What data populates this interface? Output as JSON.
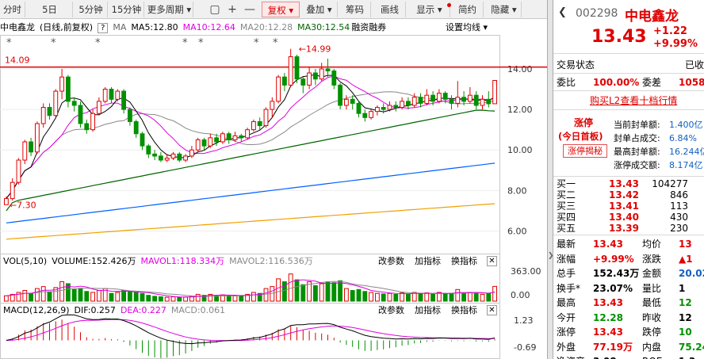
{
  "toolbar": {
    "items": [
      {
        "label": "分时",
        "active": false
      },
      {
        "label": "5日",
        "active": false
      },
      {
        "label": "5分钟",
        "active": false
      },
      {
        "label": "15分钟",
        "active": false
      },
      {
        "label": "更多周期 ▾",
        "active": false
      },
      {
        "label": "复权 ▾",
        "active": true
      },
      {
        "label": "叠加 ▾",
        "active": false
      },
      {
        "label": "筹码",
        "active": false
      },
      {
        "label": "画线",
        "active": false
      },
      {
        "label": "显示 ▾",
        "active": false
      },
      {
        "label": "简约",
        "active": false
      },
      {
        "label": "隐藏 ▾",
        "active": false
      }
    ],
    "icons": [
      "▢",
      "+",
      "—"
    ]
  },
  "main_indicators": {
    "stock": "中电鑫龙",
    "mode": "(日线,前复权)",
    "help": "?",
    "ma": "MA",
    "ma5": "MA5:12.80",
    "ma10": "MA10:12.64",
    "ma20": "MA20:12.28",
    "ma30": "MA30:12.54",
    "rz": "融资融券",
    "settings": "设置均线 ▾"
  },
  "vol_indicators": {
    "name": "VOL(5,10)",
    "volume": "VOLUME:152.426万",
    "mavol1": "MAVOL1:118.334万",
    "mavol2": "MAVOL2:116.536万",
    "btn1": "改参数",
    "btn2": "加指标",
    "btn3": "换指标",
    "close": "✕"
  },
  "macd_indicators": {
    "name": "MACD(12,26,9)",
    "dif": "DIF:0.257",
    "dea": "DEA:0.227",
    "macd": "MACD:0.061",
    "btn1": "改参数",
    "btn2": "加指标",
    "btn3": "换指标",
    "close": "✕"
  },
  "colors": {
    "up": "#e00000",
    "down": "#009000",
    "ma5": "#000000",
    "ma10": "#e000e0",
    "ma20": "#888888",
    "ma30": "#006400",
    "ma60": "#0060ff",
    "ma120": "#f0a000",
    "resistance": "#e00000"
  },
  "chart_data": {
    "type": "candlestick",
    "y_ticks": [
      "14.00",
      "12.00",
      "10.00",
      "8.00",
      "6.00"
    ],
    "ylim": [
      5.2,
      15.6
    ],
    "resistance_label": "14.09",
    "resistance_value": 14.09,
    "high_label": "14.99",
    "low_label": "7.30",
    "candles": [
      [
        7.3,
        7.6,
        7.3,
        7.7
      ],
      [
        7.6,
        8.4,
        7.5,
        8.6
      ],
      [
        8.4,
        9.5,
        8.3,
        9.6
      ],
      [
        9.5,
        10.4,
        9.3,
        10.5
      ],
      [
        10.4,
        9.9,
        9.7,
        10.6
      ],
      [
        9.9,
        11.3,
        9.8,
        11.4
      ],
      [
        11.3,
        12.1,
        11.1,
        12.3
      ],
      [
        12.1,
        11.7,
        11.5,
        12.3
      ],
      [
        11.7,
        12.9,
        11.6,
        13.0
      ],
      [
        12.9,
        13.6,
        12.5,
        14.0
      ],
      [
        13.6,
        12.4,
        12.1,
        13.7
      ],
      [
        12.4,
        12.2,
        11.9,
        12.6
      ],
      [
        12.2,
        11.3,
        11.1,
        12.4
      ],
      [
        11.3,
        11.0,
        10.8,
        11.5
      ],
      [
        11.0,
        11.8,
        10.9,
        12.0
      ],
      [
        11.8,
        12.4,
        11.7,
        12.6
      ],
      [
        12.4,
        13.0,
        12.3,
        13.1
      ],
      [
        13.0,
        12.5,
        12.3,
        13.1
      ],
      [
        12.5,
        12.9,
        12.4,
        13.0
      ],
      [
        12.9,
        12.0,
        11.8,
        13.0
      ],
      [
        12.0,
        11.4,
        11.2,
        12.1
      ],
      [
        11.4,
        10.8,
        10.6,
        11.5
      ],
      [
        10.8,
        10.2,
        10.0,
        10.9
      ],
      [
        10.2,
        9.8,
        9.6,
        10.3
      ],
      [
        9.8,
        9.7,
        9.5,
        10.0
      ],
      [
        9.7,
        9.5,
        9.4,
        9.9
      ],
      [
        9.5,
        9.6,
        9.4,
        9.8
      ],
      [
        9.6,
        9.8,
        9.5,
        9.9
      ],
      [
        9.8,
        9.5,
        9.4,
        9.9
      ],
      [
        9.5,
        9.7,
        9.4,
        9.8
      ],
      [
        9.7,
        10.0,
        9.6,
        10.2
      ],
      [
        10.0,
        10.5,
        9.9,
        10.6
      ],
      [
        10.5,
        10.2,
        10.0,
        10.6
      ],
      [
        10.2,
        10.6,
        10.1,
        10.8
      ],
      [
        10.6,
        10.4,
        10.2,
        10.8
      ],
      [
        10.4,
        10.8,
        10.3,
        10.9
      ],
      [
        10.8,
        10.5,
        10.3,
        10.9
      ],
      [
        10.5,
        10.7,
        10.4,
        10.9
      ],
      [
        10.7,
        10.6,
        10.4,
        10.8
      ],
      [
        10.6,
        11.0,
        10.5,
        11.1
      ],
      [
        11.0,
        11.4,
        10.9,
        11.5
      ],
      [
        11.4,
        11.2,
        11.0,
        11.6
      ],
      [
        11.2,
        12.0,
        11.1,
        12.1
      ],
      [
        12.0,
        12.4,
        11.6,
        12.6
      ],
      [
        12.4,
        13.6,
        12.3,
        13.7
      ],
      [
        13.6,
        13.2,
        12.9,
        13.8
      ],
      [
        13.2,
        14.6,
        13.1,
        14.99
      ],
      [
        14.6,
        13.5,
        13.3,
        14.7
      ],
      [
        13.5,
        13.2,
        12.8,
        13.6
      ],
      [
        13.2,
        13.8,
        13.0,
        14.1
      ],
      [
        13.8,
        13.5,
        13.2,
        14.0
      ],
      [
        13.5,
        14.0,
        13.4,
        14.3
      ],
      [
        14.0,
        13.9,
        13.6,
        14.5
      ],
      [
        13.9,
        13.2,
        13.0,
        14.0
      ],
      [
        13.2,
        12.2,
        12.0,
        13.3
      ],
      [
        12.2,
        12.5,
        12.0,
        12.7
      ],
      [
        12.5,
        12.3,
        12.0,
        12.7
      ],
      [
        12.3,
        11.8,
        11.6,
        12.4
      ],
      [
        11.8,
        11.6,
        11.4,
        12.0
      ],
      [
        11.6,
        11.9,
        11.5,
        12.0
      ],
      [
        11.9,
        12.1,
        11.7,
        12.2
      ],
      [
        12.1,
        12.0,
        11.8,
        12.3
      ],
      [
        12.0,
        12.2,
        11.9,
        12.4
      ],
      [
        12.2,
        12.1,
        11.9,
        12.4
      ],
      [
        12.1,
        12.4,
        12.0,
        12.6
      ],
      [
        12.4,
        12.2,
        12.0,
        12.6
      ],
      [
        12.2,
        12.6,
        12.1,
        12.8
      ],
      [
        12.6,
        12.3,
        12.1,
        12.8
      ],
      [
        12.3,
        12.7,
        12.2,
        13.0
      ],
      [
        12.7,
        12.4,
        12.2,
        12.9
      ],
      [
        12.4,
        12.8,
        12.3,
        13.0
      ],
      [
        12.8,
        12.5,
        12.3,
        12.9
      ],
      [
        12.5,
        12.3,
        12.0,
        12.7
      ],
      [
        12.3,
        12.6,
        12.1,
        13.4
      ],
      [
        12.6,
        12.4,
        12.2,
        12.9
      ],
      [
        12.4,
        12.7,
        12.3,
        13.1
      ],
      [
        12.7,
        12.2,
        12.0,
        12.9
      ],
      [
        12.2,
        12.5,
        12.0,
        12.7
      ],
      [
        12.5,
        12.28,
        12.1,
        12.9
      ],
      [
        12.28,
        13.43,
        12.28,
        13.43
      ]
    ],
    "volumes": [
      0.55,
      0.7,
      0.9,
      1.1,
      0.8,
      1.3,
      1.5,
      0.9,
      1.4,
      2.0,
      1.8,
      1.2,
      1.3,
      1.0,
      0.9,
      1.1,
      1.3,
      0.8,
      0.9,
      1.1,
      1.0,
      0.9,
      0.8,
      0.6,
      0.5,
      0.45,
      0.4,
      0.45,
      0.4,
      0.42,
      0.5,
      0.7,
      0.6,
      0.7,
      0.55,
      0.65,
      0.6,
      0.55,
      0.5,
      0.7,
      0.9,
      0.8,
      1.3,
      1.5,
      2.3,
      2.0,
      2.8,
      2.2,
      1.7,
      2.0,
      1.6,
      1.8,
      2.0,
      1.9,
      2.1,
      1.3,
      1.1,
      1.2,
      1.0,
      0.9,
      0.8,
      0.75,
      0.8,
      0.7,
      0.85,
      0.7,
      0.9,
      0.8,
      0.85,
      0.7,
      0.9,
      0.75,
      0.8,
      1.2,
      0.8,
      0.9,
      0.8,
      0.7,
      0.8,
      1.52
    ],
    "vol_ticks": [
      "363.00",
      "0.00"
    ],
    "macd_ticks": [
      "1.23",
      "-0.69"
    ]
  },
  "quote": {
    "code": "002298",
    "name": "中电鑫龙",
    "price": "13.43",
    "change": "+1.22",
    "pct": "+9.99%",
    "trade_status_label": "交易状态",
    "trade_status_value": "已收",
    "weibi_label": "委比",
    "weibi_value": "100.00%",
    "weicha_label": "委差",
    "weicha_value": "1058",
    "l2_link": "购买L2查看十档行情",
    "zt_badge": "涨停",
    "zt_first": "(今日首板)",
    "zt_reveal": "涨停揭秘",
    "zt_stats": [
      {
        "label": "当前封单额:",
        "value": "1.400亿"
      },
      {
        "label": "封单占成交:",
        "value": "6.84%"
      },
      {
        "label": "最高封单额:",
        "value": "16.244亿"
      },
      {
        "label": "涨停成交额:",
        "value": "8.174亿"
      }
    ],
    "bids": [
      {
        "label": "买一",
        "price": "13.43",
        "vol": "104277"
      },
      {
        "label": "买二",
        "price": "13.42",
        "vol": "846"
      },
      {
        "label": "买三",
        "price": "13.41",
        "vol": "113"
      },
      {
        "label": "买四",
        "price": "13.40",
        "vol": "430"
      },
      {
        "label": "买五",
        "price": "13.39",
        "vol": "230"
      }
    ],
    "stats": [
      {
        "l1": "最新",
        "v1": "13.43",
        "c1": "red",
        "l2": "均价",
        "v2": "13",
        "c2": "red"
      },
      {
        "l1": "涨幅",
        "v1": "+9.99%",
        "c1": "red",
        "l2": "涨跌",
        "v2": "▲1",
        "c2": "red"
      },
      {
        "l1": "总手",
        "v1": "152.43万",
        "c1": "black",
        "l2": "金额",
        "v2": "20.02",
        "c2": "blue"
      },
      {
        "l1": "换手*",
        "v1": "23.07%",
        "c1": "black",
        "l2": "量比",
        "v2": "1",
        "c2": "black"
      },
      {
        "l1": "最高",
        "v1": "13.43",
        "c1": "red",
        "l2": "最低",
        "v2": "12",
        "c2": "green"
      },
      {
        "l1": "今开",
        "v1": "12.28",
        "c1": "green",
        "l2": "昨收",
        "v2": "12",
        "c2": "black"
      },
      {
        "l1": "涨停",
        "v1": "13.43",
        "c1": "red",
        "l2": "跌停",
        "v2": "10",
        "c2": "green"
      },
      {
        "l1": "外盘",
        "v1": "77.19万",
        "c1": "red",
        "l2": "内盘",
        "v2": "75.24",
        "c2": "green"
      },
      {
        "l1": "净资产",
        "v1": "3.08",
        "c1": "black",
        "l2": "ROE",
        "v2": "1.3",
        "c2": "black"
      }
    ]
  }
}
